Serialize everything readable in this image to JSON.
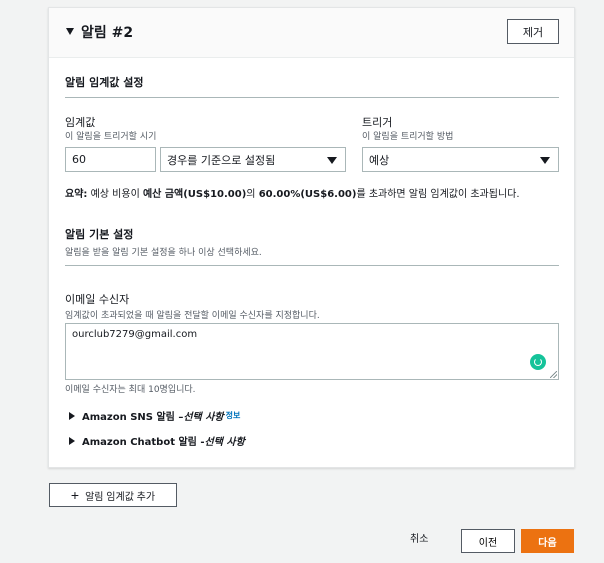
{
  "alert": {
    "title": "알림 #2",
    "remove_label": "제거",
    "threshold_section": {
      "title": "알림 임계값 설정",
      "threshold_label": "임계값",
      "threshold_desc": "이 알림을 트리거할 시기",
      "threshold_value": "60",
      "threshold_type": "경우를 기준으로 설정됨",
      "trigger_label": "트리거",
      "trigger_desc": "이 알림을 트리거할 방법",
      "trigger_value": "예상"
    },
    "summary": {
      "prefix": "요약:",
      "text1": " 예상 비용이 ",
      "bold1": "예산 금액(US$10.00)",
      "text2": "의 ",
      "bold2": "60.00%(US$6.00)",
      "text3": "를 초과하면 알림 임계값이 초과됩니다."
    },
    "basic_section": {
      "title": "알림 기본 설정",
      "desc": "알림을 받을 알림 기본 설정을 하나 이상 선택하세요."
    },
    "email": {
      "label": "이메일 수신자",
      "desc": "임계값이 초과되었을 때 알림을 전달할 이메일 수신자를 지정합니다.",
      "value": "ourclub7279@gmail.com",
      "hint": "이메일 수신자는 최대 10명입니다."
    },
    "sns": {
      "label": "Amazon SNS 알림 – ",
      "optional": "선택 사항",
      "info": "정보"
    },
    "chatbot": {
      "label": "Amazon Chatbot 알림 - ",
      "optional": "선택 사항"
    }
  },
  "footer": {
    "add_threshold": "알림 임계값 추가",
    "cancel": "취소",
    "previous": "이전",
    "next": "다음"
  },
  "colors": {
    "primary_button": "#ec7211",
    "link": "#0073bb",
    "grammarly": "#15c39a"
  }
}
